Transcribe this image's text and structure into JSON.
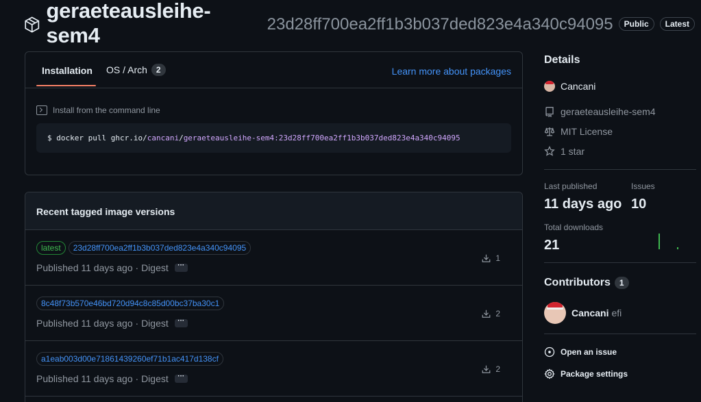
{
  "header": {
    "package_name": "geraeteausleihe-sem4",
    "package_hash": "23d28ff700ea2ff1b3b037ded823e4a340c94095",
    "badges": [
      "Public",
      "Latest"
    ]
  },
  "install": {
    "tabs": [
      {
        "label": "Installation"
      },
      {
        "label": "OS / Arch",
        "count": "2"
      }
    ],
    "learn_more": "Learn more about packages",
    "command_title": "Install from the command line",
    "command": {
      "prompt": "$",
      "pre": "docker pull ghcr.io/",
      "owner": "cancani",
      "sep": "/",
      "image": "geraeteausleihe-sem4:23d28ff700ea2ff1b3b037ded823e4a340c94095"
    }
  },
  "versions": {
    "title": "Recent tagged image versions",
    "items": [
      {
        "latest": "latest",
        "hash": "23d28ff700ea2ff1b3b037ded823e4a340c94095",
        "published": "Published 11 days ago · Digest",
        "downloads": "1"
      },
      {
        "latest": "",
        "hash": "8c48f73b570e46bd720d94c8c85d00bc37ba30c1",
        "published": "Published 11 days ago · Digest",
        "downloads": "2"
      },
      {
        "latest": "",
        "hash": "a1eab003d00e71861439260ef71b1ac417d138cf",
        "published": "Published 11 days ago · Digest",
        "downloads": "2"
      }
    ],
    "more_label": "···"
  },
  "sidebar": {
    "details_title": "Details",
    "owner": "Cancani",
    "repo": "geraeteausleihe-sem4",
    "license": "MIT License",
    "stars": "1 star",
    "last_published_label": "Last published",
    "last_published_value": "11 days ago",
    "issues_label": "Issues",
    "issues_value": "10",
    "downloads_label": "Total downloads",
    "downloads_value": "21",
    "contributors_title": "Contributors",
    "contributors_count": "1",
    "contributor_name": "Cancani",
    "contributor_extra": "efi",
    "open_issue": "Open an issue",
    "package_settings": "Package settings"
  },
  "colors": {
    "accent_link": "#4493f8",
    "tab_underline": "#f78166",
    "latest_green": "#3fb950",
    "sparkline_green": "#3fb950"
  }
}
